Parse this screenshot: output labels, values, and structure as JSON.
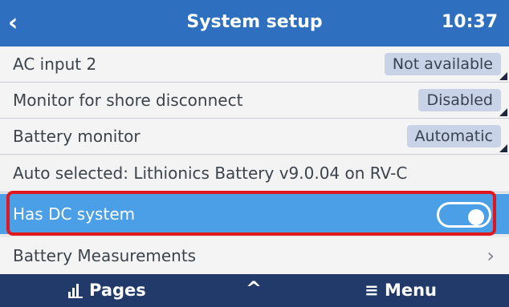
{
  "header": {
    "title": "System setup",
    "time": "10:37"
  },
  "rows": {
    "ac_input_2": {
      "label": "AC input 2",
      "value": "Not available"
    },
    "shore_disconnect": {
      "label": "Monitor for shore disconnect",
      "value": "Disabled"
    },
    "battery_monitor": {
      "label": "Battery monitor",
      "value": "Automatic"
    },
    "auto_selected": {
      "text": "Auto selected: Lithionics Battery v9.0.04 on RV-C"
    },
    "has_dc_system": {
      "label": "Has DC system",
      "enabled": true
    },
    "battery_measurements": {
      "label": "Battery Measurements"
    }
  },
  "footer": {
    "pages": "Pages",
    "menu": "Menu"
  },
  "colors": {
    "header": "#2e6fc0",
    "selected": "#4b9fe6",
    "footer": "#213a6a",
    "highlight": "#e0171f"
  }
}
